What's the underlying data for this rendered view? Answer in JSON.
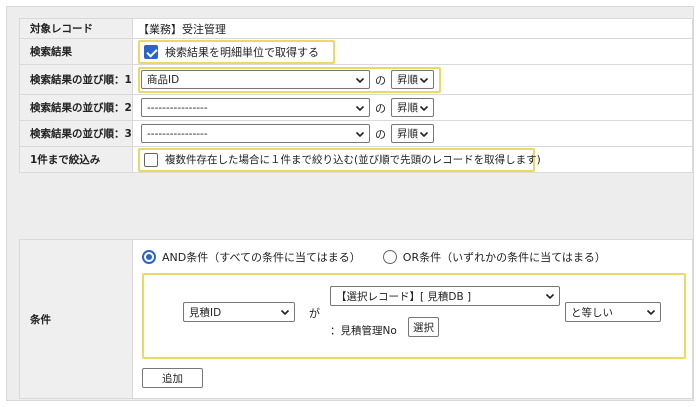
{
  "settings": {
    "target_record": {
      "label": "対象レコード",
      "value": "【業務】受注管理"
    },
    "search_result": {
      "label": "検索結果",
      "checkbox_label": "検索結果を明細単位で取得する",
      "checked": true
    },
    "sort1": {
      "label": "検索結果の並び順：1",
      "field": "商品ID",
      "connector": "の",
      "order": "昇順"
    },
    "sort2": {
      "label": "検索結果の並び順：2",
      "field": "----------------",
      "connector": "の",
      "order": "昇順"
    },
    "sort3": {
      "label": "検索結果の並び順：3",
      "field": "----------------",
      "connector": "の",
      "order": "昇順"
    },
    "narrow": {
      "label": "1件まで絞込み",
      "checkbox_label": "複数件存在した場合に１件まで絞り込む(並び順で先頭のレコードを取得します)",
      "checked": false
    }
  },
  "conditions": {
    "label": "条件",
    "and_option": "AND条件（すべての条件に当てはまる）",
    "or_option": "OR条件（いずれかの条件に当てはまる）",
    "selected_mode": "AND",
    "field": "見積ID",
    "particle": "が",
    "source": "【選択レコード】[ 見積DB ]",
    "source_field": "：見積管理No",
    "select_button": "選択",
    "operator": "と等しい",
    "add_button": "追加"
  },
  "colors": {
    "highlight": "#ebd966",
    "accent": "#2a63c9",
    "label_bg": "#efefef",
    "page_bg": "#ededed"
  },
  "icons": {
    "dropdown": "chevron-down-icon",
    "checkbox": "checkmark-icon"
  }
}
